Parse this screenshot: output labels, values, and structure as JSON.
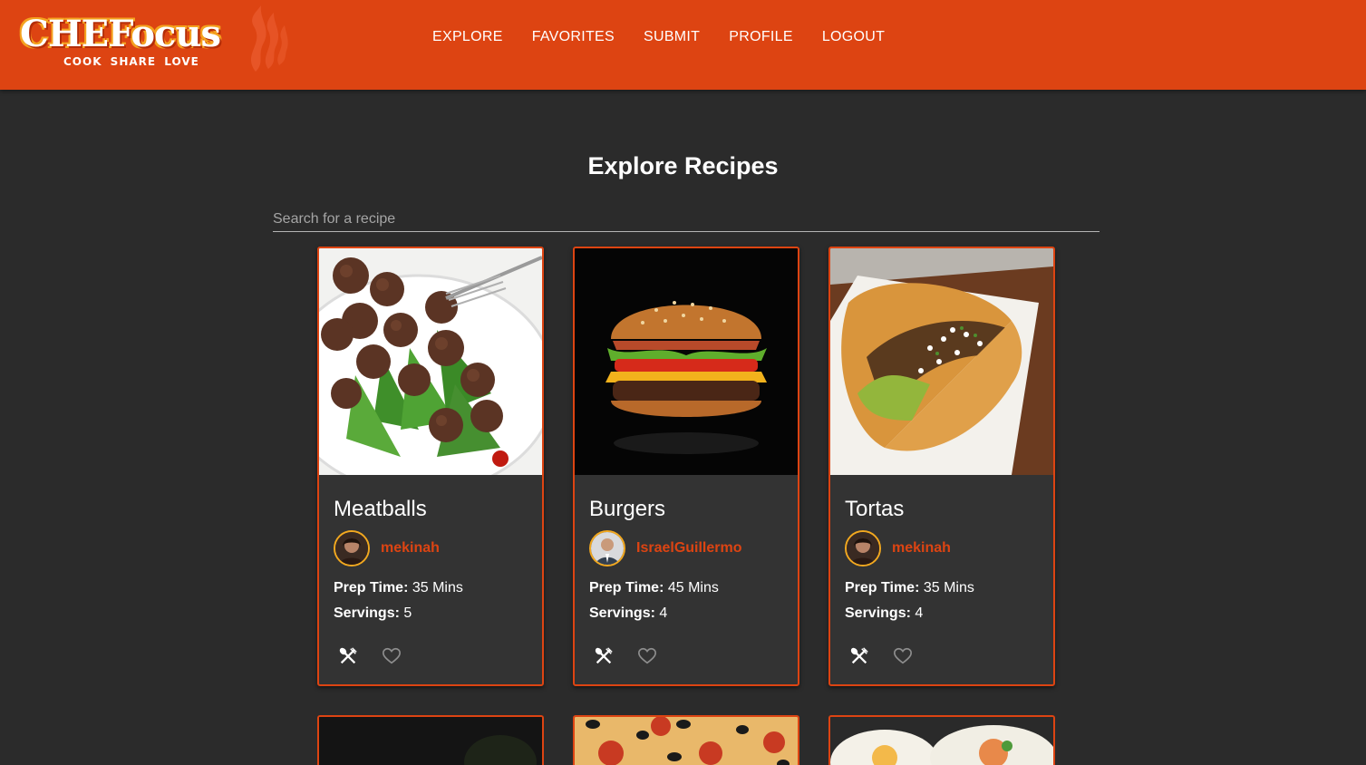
{
  "app": {
    "logo_text": "CHEFocus",
    "logo_tagline": "COOK SHARE LOVE",
    "brand_color": "#dd4412",
    "nav": [
      "EXPLORE",
      "FAVORITES",
      "SUBMIT",
      "PROFILE",
      "LOGOUT"
    ]
  },
  "page": {
    "title": "Explore Recipes",
    "search_placeholder": "Search for a recipe"
  },
  "labels": {
    "prep_time": "Prep Time:",
    "servings": "Servings:"
  },
  "recipes": [
    {
      "title": "Meatballs",
      "author": "mekinah",
      "prep": "35 Mins",
      "servings": "5",
      "image": "meatballs-photo"
    },
    {
      "title": "Burgers",
      "author": "IsraelGuillermo",
      "prep": "45 Mins",
      "servings": "4",
      "image": "burger-photo"
    },
    {
      "title": "Tortas",
      "author": "mekinah",
      "prep": "35 Mins",
      "servings": "4",
      "image": "torta-photo"
    }
  ],
  "partial_cards": [
    "dark-photo",
    "pizza-photo",
    "sushi-photo"
  ],
  "icons": {
    "cook": "fork-spoon-icon",
    "favorite": "heart-outline-icon"
  }
}
